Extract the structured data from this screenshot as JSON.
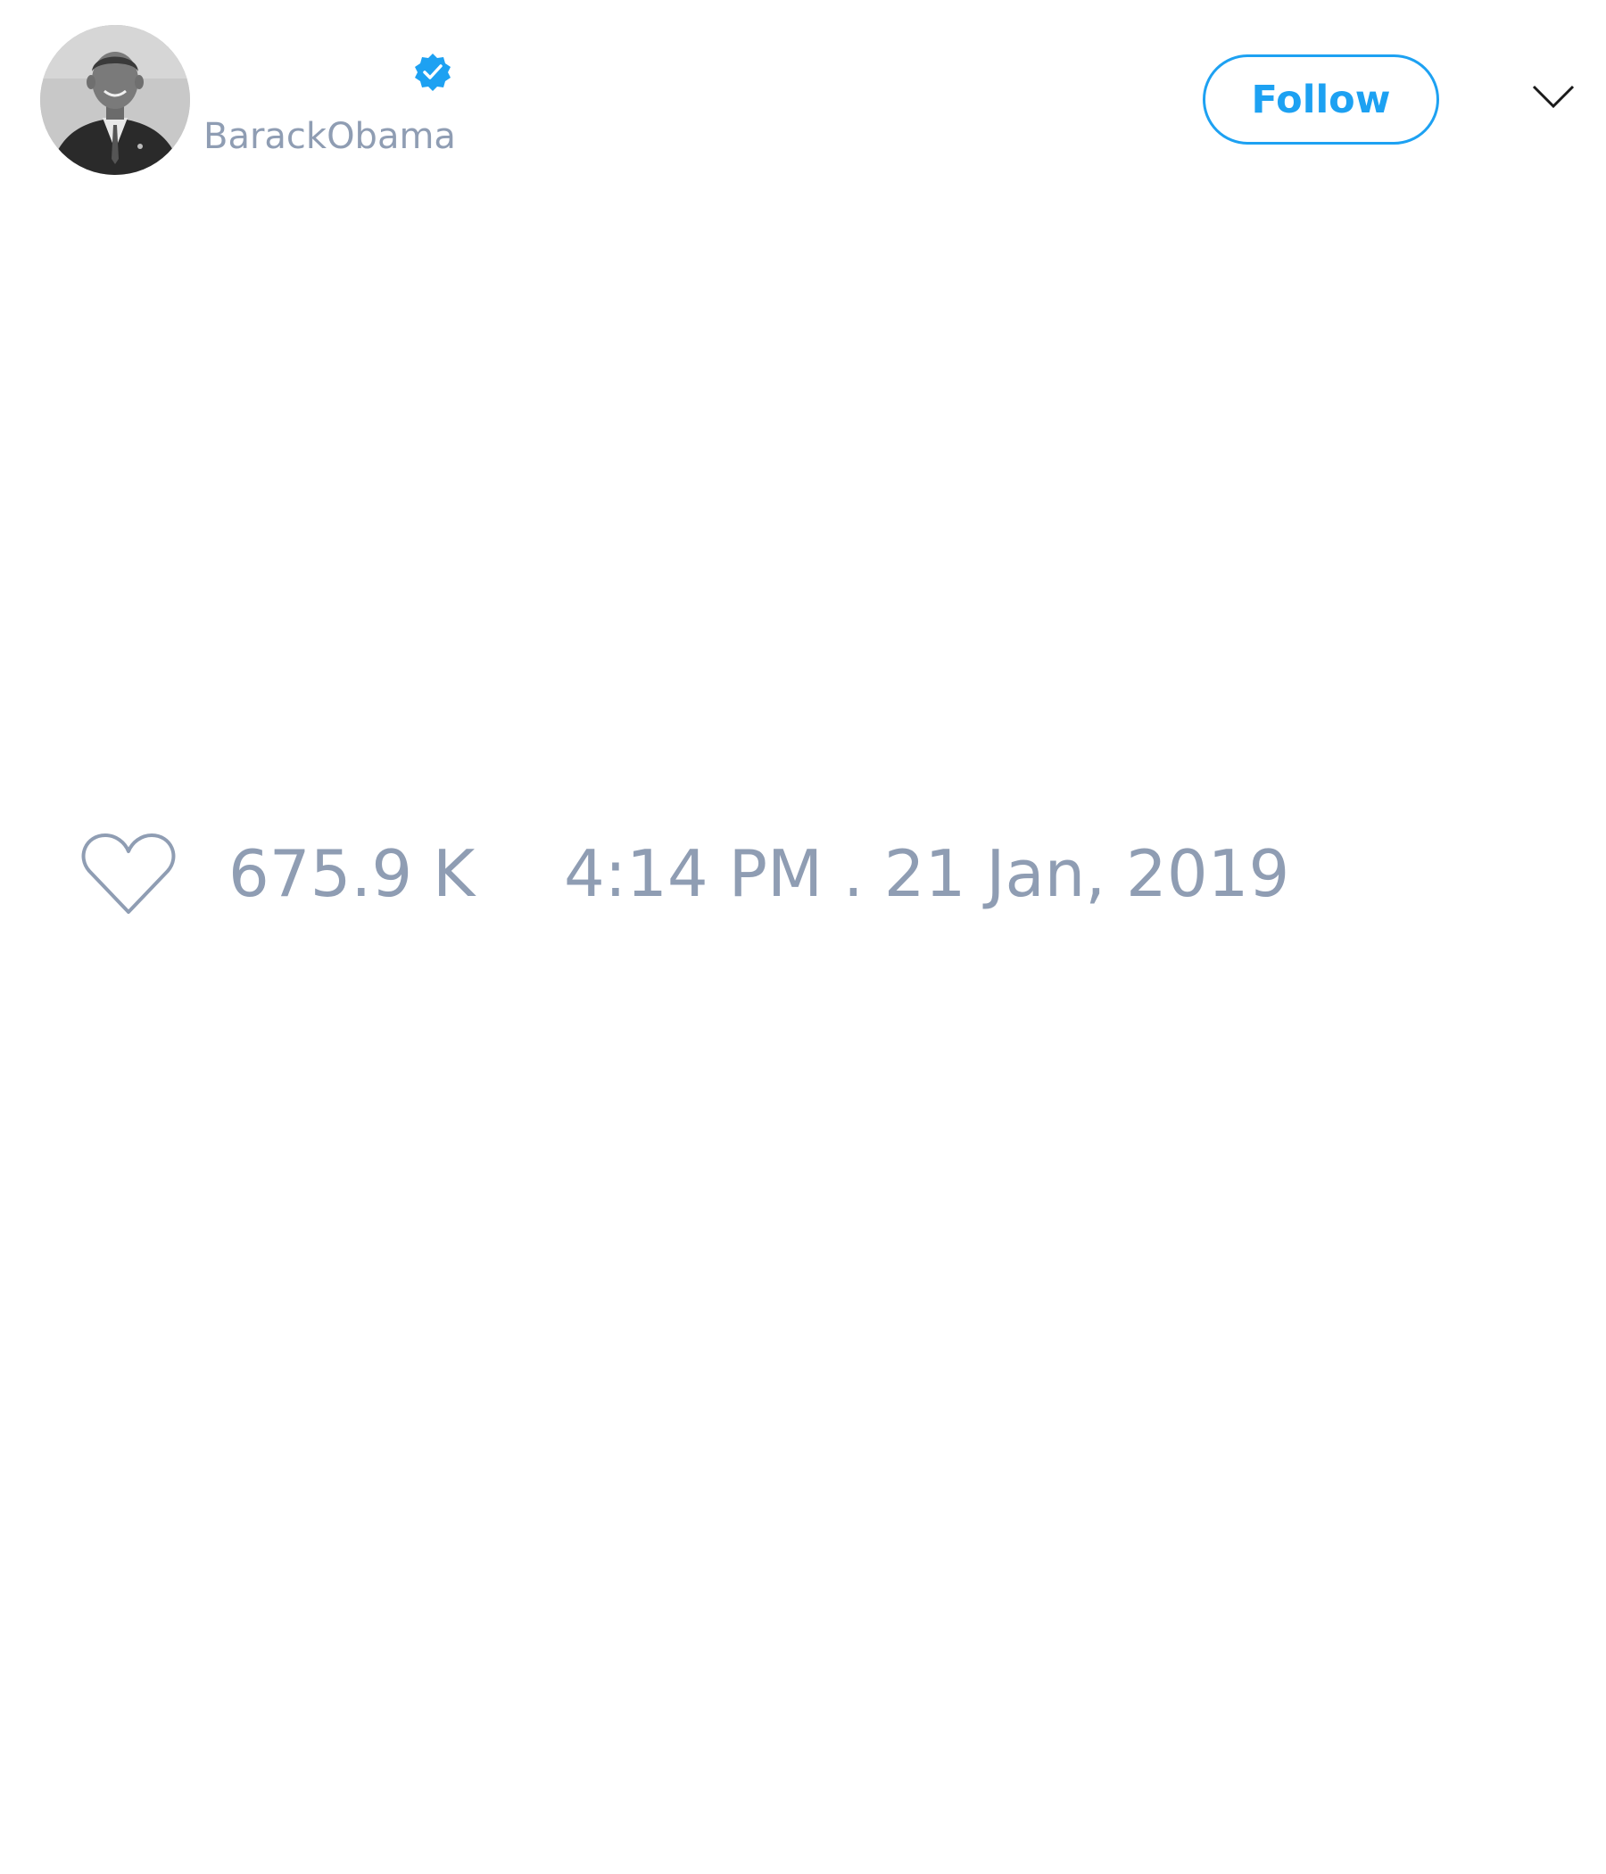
{
  "author": {
    "handle": "BarackObama",
    "verified": true,
    "avatar_icon": "profile-photo"
  },
  "actions": {
    "follow_label": "Follow",
    "menu_icon": "chevron-down-icon"
  },
  "engagement": {
    "like_icon": "heart-icon",
    "like_count": "675.9 K",
    "timestamp": "4:14 PM . 21 Jan, 2019"
  },
  "colors": {
    "accent": "#1da1f2",
    "muted_text": "#8f9db3",
    "background": "#ffffff"
  }
}
